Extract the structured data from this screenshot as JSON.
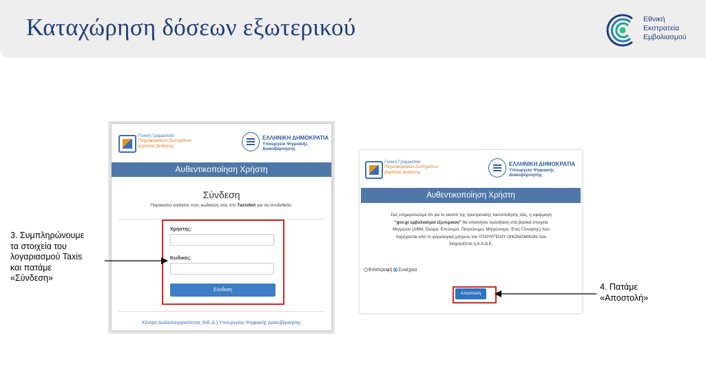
{
  "slide": {
    "title": "Καταχώρηση δόσεων εξωτερικού",
    "logo_text": [
      "Εθνική",
      "Εκστρατεία",
      "Εμβολιασμού"
    ]
  },
  "login_screen": {
    "gsis_lines": [
      "Γενική Γραμματεία",
      "Πληροφοριακών Συστημάτων",
      "Δημόσιας Διοίκησης"
    ],
    "republic_lines": [
      "ΕΛΛΗΝΙΚΗ ΔΗΜΟΚΡΑΤΙΑ",
      "Υπουργείο Ψηφιακής",
      "Διακυβέρνησης"
    ],
    "auth_title": "Αυθεντικοποίηση Χρήστη",
    "signin_title": "Σύνδεση",
    "signin_sub_pre": "Παρακαλώ εισάγετε τους κωδικούς σας στο ",
    "signin_sub_bold": "TaxisNet",
    "signin_sub_post": " για να συνδεθείτε.",
    "username_label": "Χρήστης:",
    "password_label": "Κωδικός:",
    "login_button": "Σύνδεση",
    "footer": "Κέντρο Διαλειτουργικότητας (ΚΕ.Δ.) Υπουργείου Ψηφιακής Διακυβέρνησης"
  },
  "consent_screen": {
    "gsis_lines": [
      "Γενική Γραμματεία",
      "Πληροφοριακών Συστημάτων",
      "Δημόσιας Διοίκησης"
    ],
    "republic_lines": [
      "ΕΛΛΗΝΙΚΗ ΔΗΜΟΚΡΑΤΙΑ",
      "Υπουργείο Ψηφιακής",
      "Διακυβέρνησης"
    ],
    "auth_title": "Αυθεντικοποίηση Χρήστη",
    "info_line1": "Σας ενημερώνουμε ότι για το σκοπό της ηλεκτρονικής ταυτοποίησής σας, η εφαρμογή",
    "info_app_name": "\"gov.gr εμβολιασμοί εξωτερικού\"",
    "info_line2_post": " θα αποκτήσει πρόσβαση στα βασικά στοιχεία",
    "info_line3": "Μητρώου (ΑΦΜ, Όνομα, Επώνυμο, Πατρώνυμο, Μητρώνυμο, Έτος Γέννησης) που",
    "info_line4": "παρέχονται από το φορολογικό μητρώο του ΥΠΟΥΡΓΕΙΟΥ ΟΙΚΟΝΟΜΙΚΩΝ που",
    "info_line5": "διαχειρίζεται η Α.Α.Δ.Ε.",
    "radio_back": "Επιστροφή",
    "radio_continue": "Συνέχεια",
    "send_button": "Αποστολή"
  },
  "annotations": {
    "step3": [
      "3. Συμπληρώνουμε",
      "τα στοιχεία του",
      "λογαριασμού Taxis",
      "και πατάμε",
      "«Σύνδεση»"
    ],
    "step4": [
      "4. Πατάμε",
      "«Αποστολή»"
    ]
  },
  "colors": {
    "title_blue": "#1f3d7a",
    "header_bar": "#4f77a8",
    "button_blue": "#3d7dc4",
    "highlight_red": "#e02020",
    "logo_teal": "#1fa58a"
  }
}
